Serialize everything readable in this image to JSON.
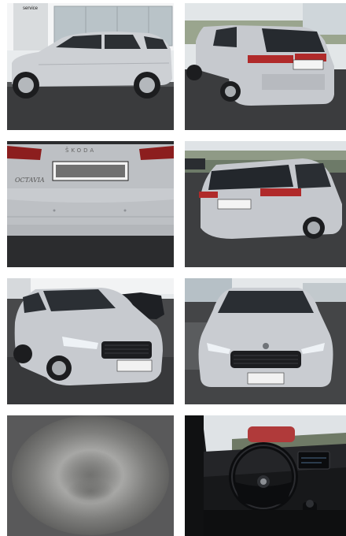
{
  "gallery": {
    "photos": [
      {
        "view": "side-left",
        "sign_text": "service"
      },
      {
        "view": "rear-three-quarter-left"
      },
      {
        "view": "tailgate-closeup",
        "badge_brand": "ŠKODA",
        "badge_model": "OCTAVIA"
      },
      {
        "view": "rear-three-quarter-right"
      },
      {
        "view": "front-three-quarter-left"
      },
      {
        "view": "front"
      },
      {
        "view": "blurred-placeholder"
      },
      {
        "view": "interior-dashboard"
      }
    ]
  },
  "colors": {
    "body_silver": "#c9ccd1",
    "asphalt": "#2e2f31",
    "sky": "#dfe3e6",
    "interior": "#17181a"
  }
}
